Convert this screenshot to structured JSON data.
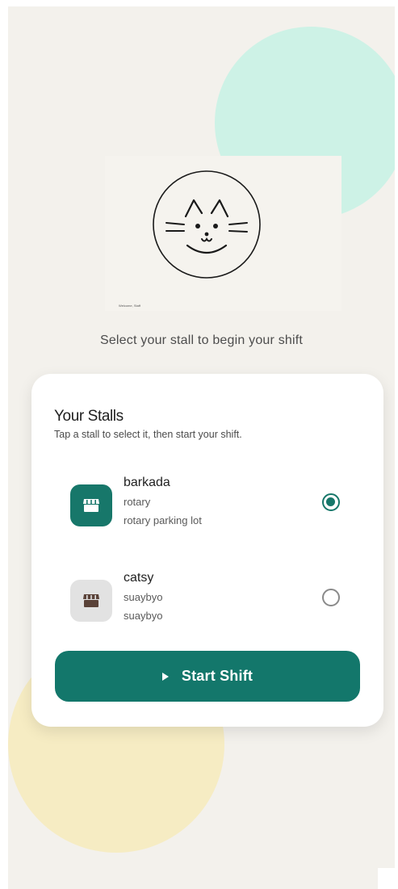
{
  "colors": {
    "background": "#f3f1ec",
    "accent": "#13776b",
    "mint_circle": "#cdf2e6",
    "yellow_circle": "#f6ecc3",
    "card": "#ffffff"
  },
  "header": {
    "logo_icon": "cat-face-icon",
    "welcome_text": "Welcome, Staff",
    "subtitle": "Select your stall to begin your shift"
  },
  "stalls_card": {
    "title": "Your Stalls",
    "instruction": "Tap a stall to select it, then start your shift.",
    "stalls": [
      {
        "name": "barkada",
        "line1": "rotary",
        "line2": "rotary parking lot",
        "icon": "storefront-icon",
        "selected": true
      },
      {
        "name": "catsy",
        "line1": "suaybyo",
        "line2": "suaybyo",
        "icon": "storefront-icon",
        "selected": false
      }
    ],
    "start_button": {
      "label": "Start Shift",
      "icon": "play-icon"
    }
  }
}
